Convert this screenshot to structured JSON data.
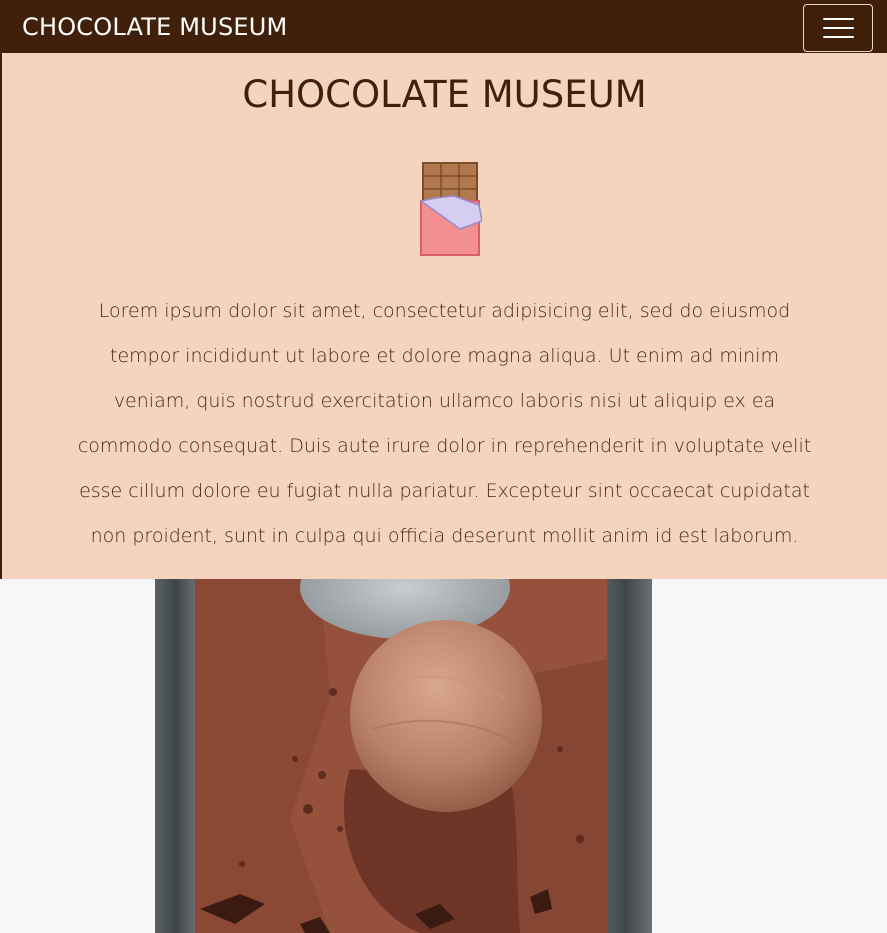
{
  "navbar": {
    "brand": "CHOCOLATE MUSEUM",
    "toggle_icon": "hamburger-menu-icon"
  },
  "hero": {
    "title": "CHOCOLATE MUSEUM",
    "icon": "chocolate-bar-icon",
    "text": "Lorem ipsum dolor sit amet, consectetur adipisicing elit, sed do eiusmod tempor incididunt ut labore et dolore magna aliqua. Ut enim ad minim veniam, quis nostrud exercitation ullamco laboris nisi ut aliquip ex ea commodo consequat. Duis aute irure dolor in reprehenderit in voluptate velit esse cillum dolore eu fugiat nulla pariatur. Excepteur sint occaecat cupidatat non proident, sunt in culpa qui officia deserunt mollit anim id est laborum."
  },
  "colors": {
    "navbar_bg": "#41200b",
    "hero_bg": "#f4d4bc",
    "title_color": "#41200b",
    "text_color": "#4a2716",
    "image_bg": "#f8f7f8"
  },
  "image": {
    "subject": "chocolate-ice-cream-photo"
  }
}
